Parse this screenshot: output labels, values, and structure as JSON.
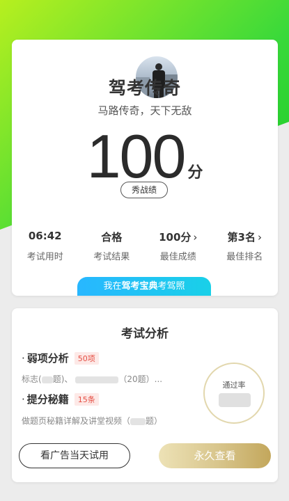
{
  "profile": {
    "name": "驾考传奇",
    "motto": "马路传奇，天下无敌"
  },
  "score": {
    "value": "100",
    "unit": "分",
    "share_label": "秀战绩"
  },
  "stats": [
    {
      "value": "06:42",
      "label": "考试用时",
      "has_chevron": false
    },
    {
      "value": "合格",
      "label": "考试结果",
      "has_chevron": false
    },
    {
      "value": "100分",
      "label": "最佳成绩",
      "has_chevron": true
    },
    {
      "value": "第3名",
      "label": "最佳排名",
      "has_chevron": true
    }
  ],
  "banner": {
    "prefix": "我在",
    "brand": "驾考宝典",
    "suffix": "考驾照"
  },
  "analysis": {
    "title": "考试分析",
    "weak": {
      "bullet": "·",
      "label": "弱项分析",
      "tag": "50项",
      "desc_a": "标志(",
      "desc_b": "题)、",
      "desc_c": "（20题）..."
    },
    "tips": {
      "bullet": "·",
      "label": "提分秘籍",
      "tag": "15条",
      "desc_a": "做题页秘籍详解及讲堂视频（",
      "desc_b": "题）"
    },
    "pass_rate_label": "通过率"
  },
  "buttons": {
    "ad_trial": "看广告当天试用",
    "permanent": "永久查看"
  },
  "colors": {
    "hero_green": "#39d93a",
    "banner_blue": "#28b7ff",
    "tag_red": "#e54d42",
    "gold": "#c3a75c"
  }
}
